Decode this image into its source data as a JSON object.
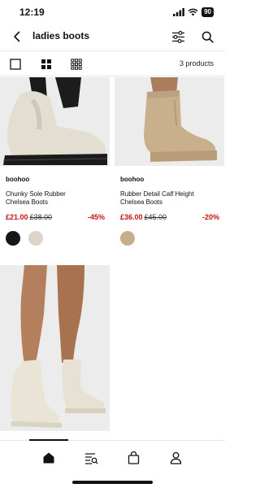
{
  "status": {
    "time": "12:19",
    "battery": "90"
  },
  "header": {
    "title": "ladies boots"
  },
  "toolbar": {
    "product_count": "3 products"
  },
  "products": [
    {
      "brand": "boohoo",
      "name": "Chunky Sole Rubber Chelsea Boots",
      "price_now": "£21.00",
      "price_was": "£38.00",
      "discount": "-45%",
      "swatches": [
        "#15161a",
        "#ddd3c8"
      ]
    },
    {
      "brand": "boohoo",
      "name": "Rubber Detail Calf Height Chelsea Boots",
      "price_now": "£36.00",
      "price_was": "£45.00",
      "discount": "-20%",
      "swatches": [
        "#c7ad8c"
      ]
    }
  ],
  "colors": {
    "accent": "#c41212",
    "text": "#111111"
  },
  "icons": {
    "back": "chevron-left-icon",
    "filter": "sliders-icon",
    "search": "search-icon",
    "view_single": "square-icon",
    "view_grid": "grid-2x2-icon",
    "view_small": "grid-3x3-icon",
    "tabs": [
      "home-icon",
      "shop-menu-icon",
      "bag-icon",
      "account-icon"
    ]
  }
}
